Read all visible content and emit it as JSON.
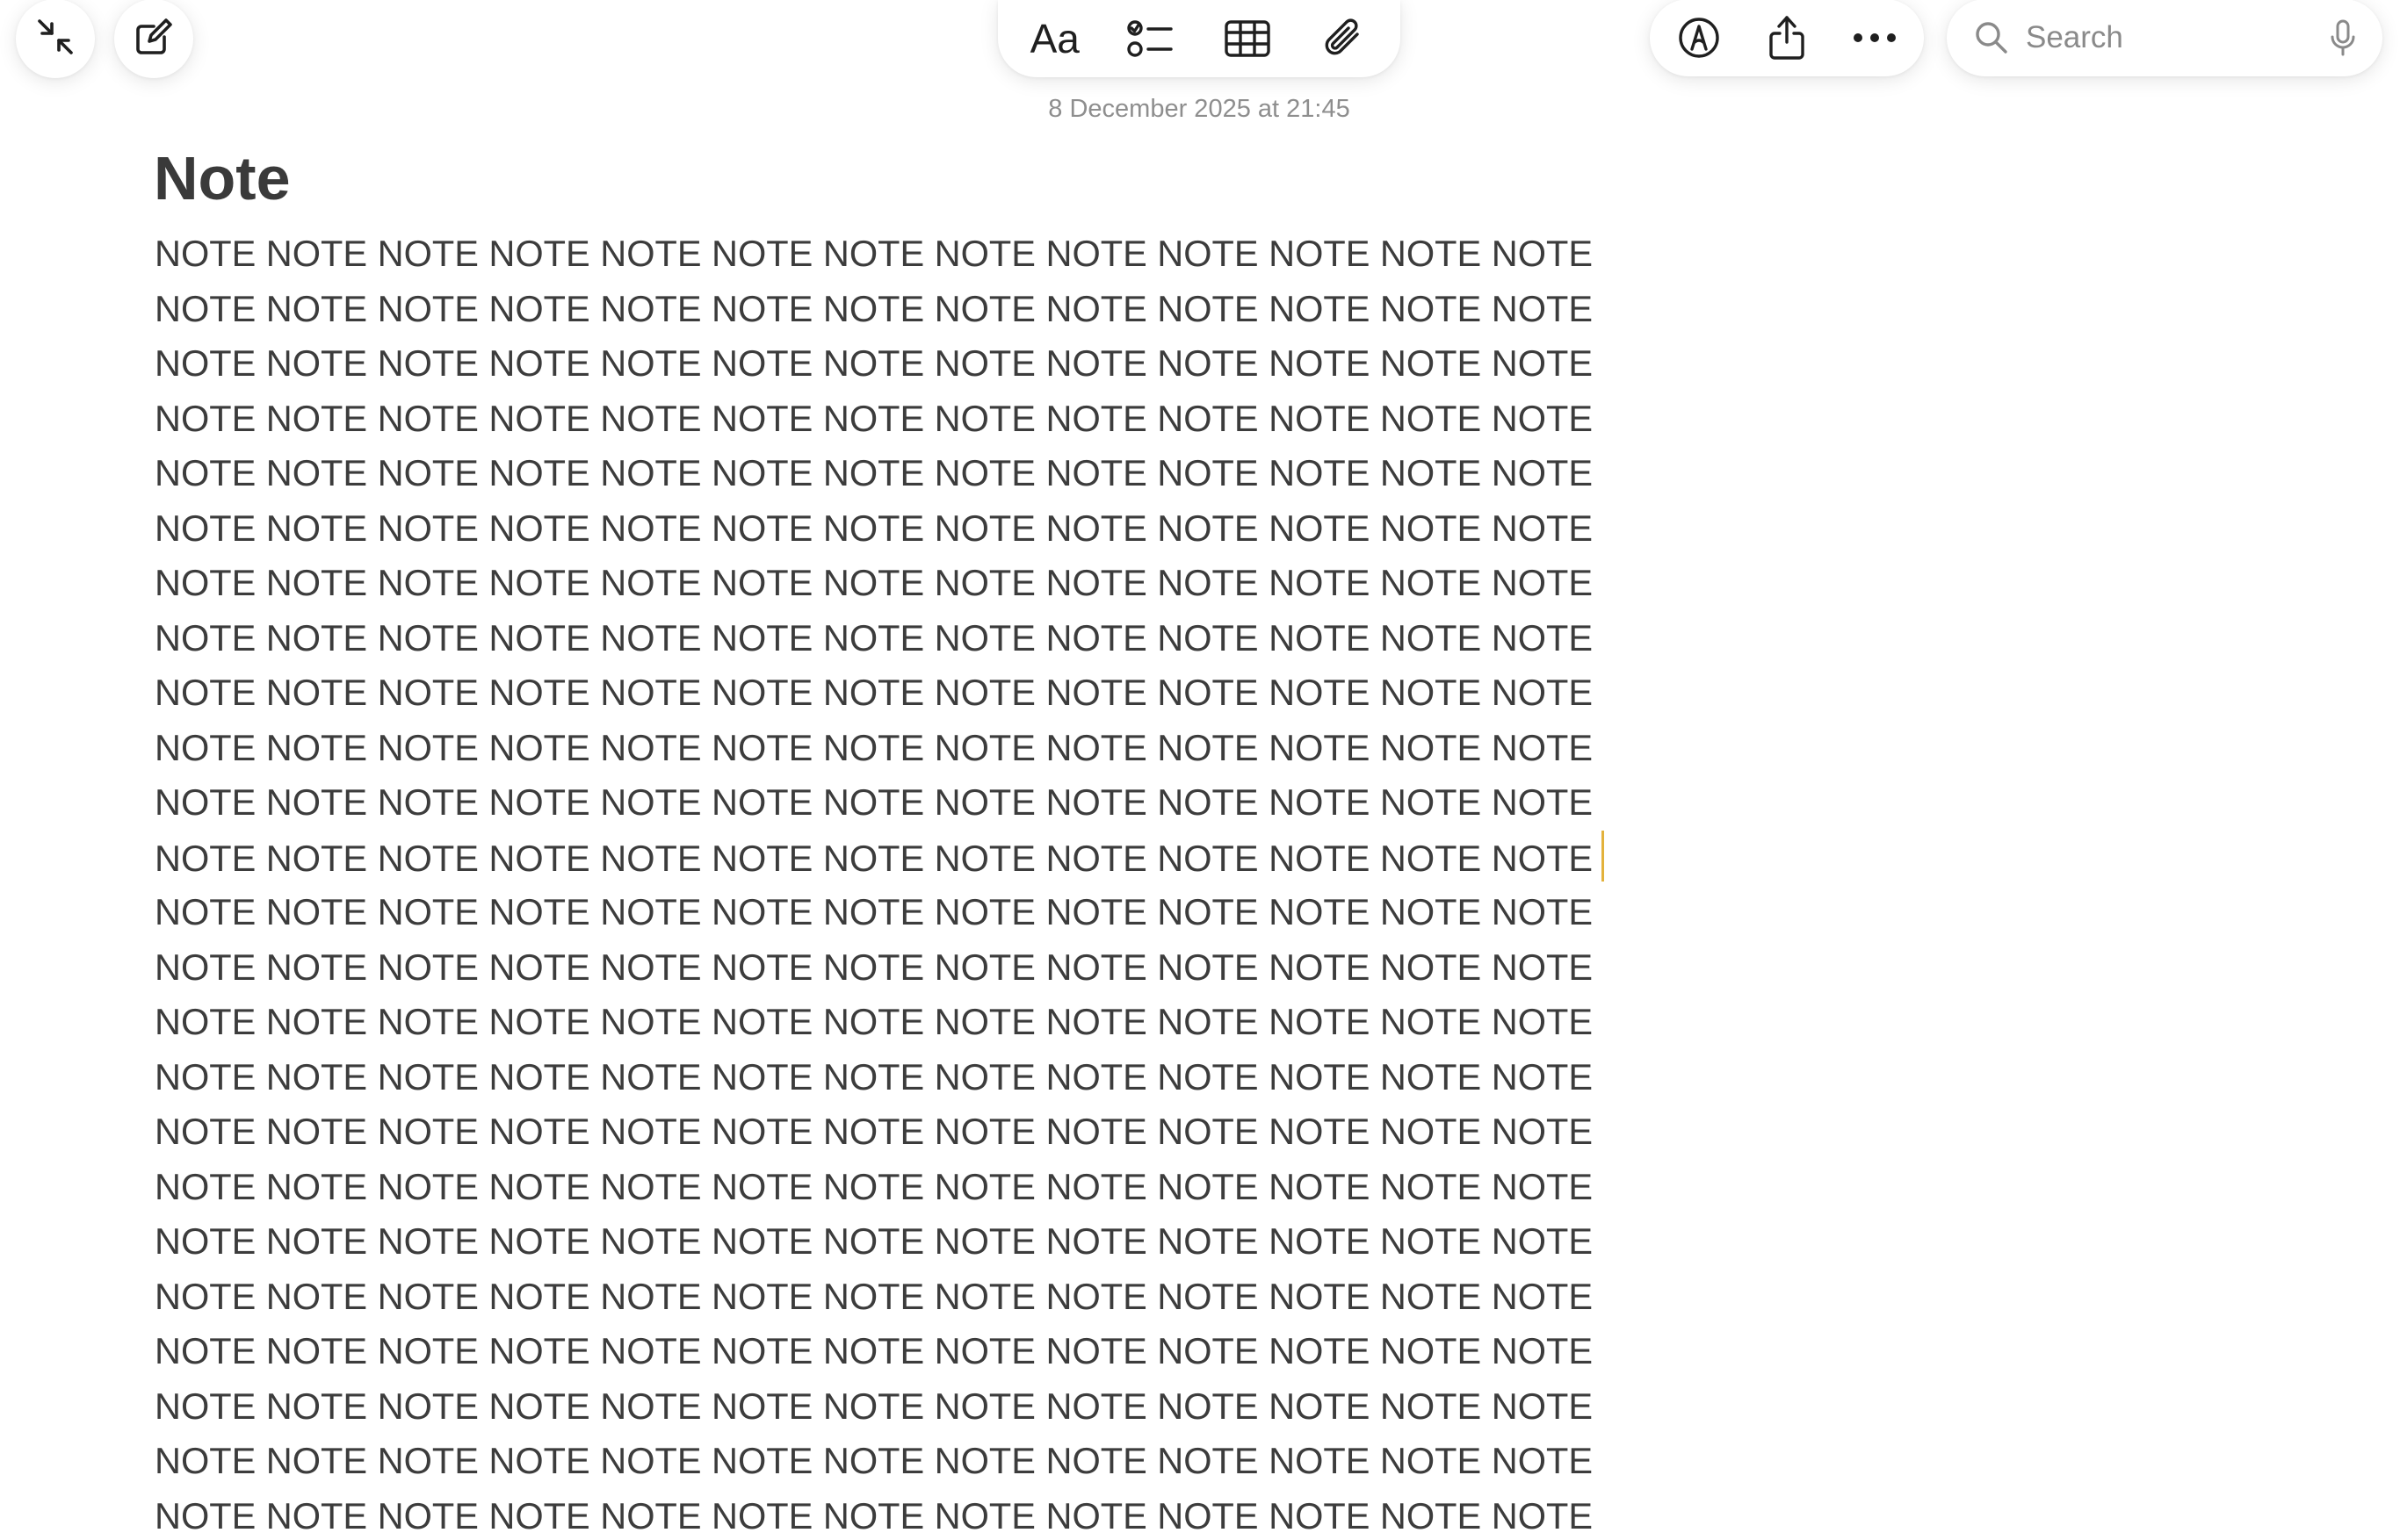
{
  "toolbar": {
    "collapse_icon": "arrows-collapse-icon",
    "compose_icon": "compose-icon",
    "format_label": "Aa",
    "checklist_icon": "checklist-icon",
    "table_icon": "table-icon",
    "attachment_icon": "paperclip-icon",
    "markup_icon": "markup-pen-icon",
    "share_icon": "share-icon",
    "more_icon": "ellipsis-icon"
  },
  "search": {
    "placeholder": "Search",
    "value": "",
    "icon": "search-icon",
    "mic_icon": "microphone-icon"
  },
  "note": {
    "timestamp": "8 December 2025 at 21:45",
    "title": "Note",
    "lines": [
      "NOTE NOTE NOTE NOTE NOTE NOTE NOTE NOTE NOTE NOTE NOTE NOTE NOTE",
      "NOTE NOTE NOTE NOTE NOTE NOTE NOTE NOTE NOTE NOTE NOTE NOTE NOTE",
      "NOTE NOTE NOTE NOTE NOTE NOTE NOTE NOTE NOTE NOTE NOTE NOTE NOTE",
      "NOTE NOTE NOTE NOTE NOTE NOTE NOTE NOTE NOTE NOTE NOTE NOTE NOTE",
      "NOTE NOTE NOTE NOTE NOTE NOTE NOTE NOTE NOTE NOTE NOTE NOTE NOTE",
      "NOTE NOTE NOTE NOTE NOTE NOTE NOTE NOTE NOTE NOTE NOTE NOTE NOTE",
      "NOTE NOTE NOTE NOTE NOTE NOTE NOTE NOTE NOTE NOTE NOTE NOTE NOTE",
      "NOTE NOTE NOTE NOTE NOTE NOTE NOTE NOTE NOTE NOTE NOTE NOTE NOTE",
      "NOTE NOTE NOTE NOTE NOTE NOTE NOTE NOTE NOTE NOTE NOTE NOTE NOTE",
      "NOTE NOTE NOTE NOTE NOTE NOTE NOTE NOTE NOTE NOTE NOTE NOTE NOTE",
      "NOTE NOTE NOTE NOTE NOTE NOTE NOTE NOTE NOTE NOTE NOTE NOTE NOTE",
      "NOTE NOTE NOTE NOTE NOTE NOTE NOTE NOTE NOTE NOTE NOTE NOTE NOTE",
      "NOTE NOTE NOTE NOTE NOTE NOTE NOTE NOTE NOTE NOTE NOTE NOTE NOTE",
      "NOTE NOTE NOTE NOTE NOTE NOTE NOTE NOTE NOTE NOTE NOTE NOTE NOTE",
      "NOTE NOTE NOTE NOTE NOTE NOTE NOTE NOTE NOTE NOTE NOTE NOTE NOTE",
      "NOTE NOTE NOTE NOTE NOTE NOTE NOTE NOTE NOTE NOTE NOTE NOTE NOTE",
      "NOTE NOTE NOTE NOTE NOTE NOTE NOTE NOTE NOTE NOTE NOTE NOTE NOTE",
      "NOTE NOTE NOTE NOTE NOTE NOTE NOTE NOTE NOTE NOTE NOTE NOTE NOTE",
      "NOTE NOTE NOTE NOTE NOTE NOTE NOTE NOTE NOTE NOTE NOTE NOTE NOTE",
      "NOTE NOTE NOTE NOTE NOTE NOTE NOTE NOTE NOTE NOTE NOTE NOTE NOTE",
      "NOTE NOTE NOTE NOTE NOTE NOTE NOTE NOTE NOTE NOTE NOTE NOTE NOTE",
      "NOTE NOTE NOTE NOTE NOTE NOTE NOTE NOTE NOTE NOTE NOTE NOTE NOTE",
      "NOTE NOTE NOTE NOTE NOTE NOTE NOTE NOTE NOTE NOTE NOTE NOTE NOTE",
      "NOTE NOTE NOTE NOTE NOTE NOTE NOTE NOTE NOTE NOTE NOTE NOTE NOTE"
    ],
    "cursor_line": 11
  },
  "colors": {
    "caret": "#e3b23c",
    "icon": "#1f1f1f",
    "body_text": "#3c3c3c",
    "title_text": "#3a3a3a",
    "timestamp_text": "#8e8e8e"
  }
}
